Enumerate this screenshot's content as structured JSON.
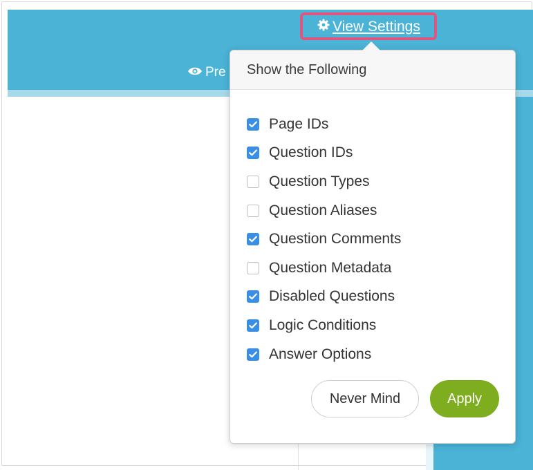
{
  "header": {
    "preview_label": "Pre",
    "view_settings_label": "View Settings",
    "view_settings_icon": "gear-icon",
    "preview_icon": "eye-icon"
  },
  "popover": {
    "title": "Show the Following",
    "options": [
      {
        "label": "Page IDs",
        "checked": true
      },
      {
        "label": "Question IDs",
        "checked": true
      },
      {
        "label": "Question Types",
        "checked": false
      },
      {
        "label": "Question Aliases",
        "checked": false
      },
      {
        "label": "Question Comments",
        "checked": true
      },
      {
        "label": "Question Metadata",
        "checked": false
      },
      {
        "label": "Disabled Questions",
        "checked": true
      },
      {
        "label": "Logic Conditions",
        "checked": true
      },
      {
        "label": "Answer Options",
        "checked": true
      }
    ],
    "cancel_label": "Never Mind",
    "apply_label": "Apply"
  },
  "colors": {
    "header_blue": "#4ab3d6",
    "highlight_pink": "#e0567e",
    "checkbox_blue": "#3a8ee6",
    "apply_green": "#7eae1f"
  }
}
